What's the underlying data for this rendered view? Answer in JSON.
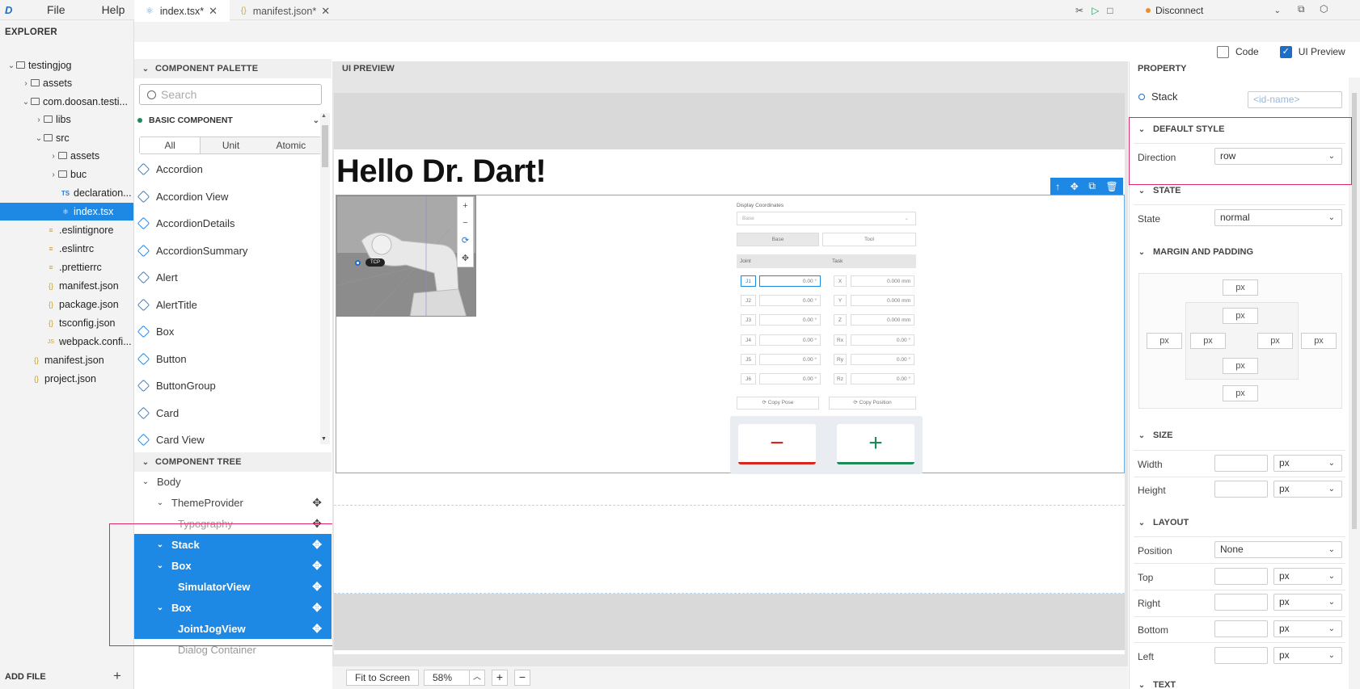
{
  "menubar": {
    "items": [
      "File",
      "Help"
    ],
    "logo": "D"
  },
  "toolbar": {
    "connection_label": "Disconnect"
  },
  "explorer": {
    "title": "EXPLORER",
    "items": [
      {
        "label": "testingjog"
      },
      {
        "label": "assets"
      },
      {
        "label": "com.doosan.testi..."
      },
      {
        "label": "libs"
      },
      {
        "label": "src"
      },
      {
        "label": "assets"
      },
      {
        "label": "buc"
      },
      {
        "label": "declaration..."
      },
      {
        "label": "index.tsx"
      },
      {
        "label": ".eslintignore"
      },
      {
        "label": ".eslintrc"
      },
      {
        "label": ".prettierrc"
      },
      {
        "label": "manifest.json"
      },
      {
        "label": "package.json"
      },
      {
        "label": "tsconfig.json"
      },
      {
        "label": "webpack.confi..."
      },
      {
        "label": "manifest.json"
      },
      {
        "label": "project.json"
      }
    ],
    "add_file": "ADD FILE"
  },
  "tabs": [
    {
      "label": "index.tsx*"
    },
    {
      "label": "manifest.json*"
    }
  ],
  "view_toggle": {
    "code": "Code",
    "ui_preview": "UI Preview"
  },
  "palette": {
    "title": "COMPONENT PALETTE",
    "search_placeholder": "Search",
    "group": "BASIC COMPONENT",
    "filters": [
      "All",
      "Unit",
      "Atomic"
    ],
    "items": [
      "Accordion",
      "Accordion View",
      "AccordionDetails",
      "AccordionSummary",
      "Alert",
      "AlertTitle",
      "Box",
      "Button",
      "ButtonGroup",
      "Card",
      "Card View"
    ]
  },
  "component_tree": {
    "title": "COMPONENT TREE",
    "items": [
      "Body",
      "ThemeProvider",
      "Typography",
      "Stack",
      "Box",
      "SimulatorView",
      "Box",
      "JointJogView",
      "Dialog Container"
    ]
  },
  "preview": {
    "title": "UI PREVIEW",
    "heading": "Hello Dr. Dart!",
    "tcp": "TCP",
    "jog": {
      "display_coordinates": "Display Coordinates",
      "base_select": "Base",
      "base_btn": "Base",
      "tool_btn": "Tool",
      "joint": "Joint",
      "task": "Task",
      "joints": [
        "J1",
        "J2",
        "J3",
        "J4",
        "J5",
        "J6"
      ],
      "joint_values": [
        "0.00 °",
        "0.00 °",
        "0.00 °",
        "0.00 °",
        "0.00 °",
        "0.00 °"
      ],
      "axes": [
        "X",
        "Y",
        "Z",
        "Rx",
        "Ry",
        "Rz"
      ],
      "axis_values": [
        "0.000 mm",
        "0.000 mm",
        "0.000 mm",
        "0.00 °",
        "0.00 °",
        "0.00 °"
      ],
      "copy_pose": "Copy Pose",
      "copy_position": "Copy Position",
      "minus": "−",
      "plus": "+"
    },
    "fit_label": "Fit to Screen",
    "zoom": "58%"
  },
  "property": {
    "title": "PROPERTY",
    "component": "Stack",
    "id_placeholder": "<id-name>",
    "sections": {
      "default_style": "DEFAULT STYLE",
      "state": "STATE",
      "margin_padding": "MARGIN AND PADDING",
      "size": "SIZE",
      "layout": "LAYOUT",
      "text": "TEXT"
    },
    "direction_label": "Direction",
    "direction_value": "row",
    "state_label": "State",
    "state_value": "normal",
    "px": "px",
    "width_label": "Width",
    "height_label": "Height",
    "position_label": "Position",
    "position_value": "None",
    "top_label": "Top",
    "right_label": "Right",
    "bottom_label": "Bottom",
    "left_label": "Left"
  },
  "colors": {
    "accent": "#1e88e5",
    "highlight": "#e0266a",
    "minus": "#d9261c",
    "plus": "#1d8a5a"
  }
}
